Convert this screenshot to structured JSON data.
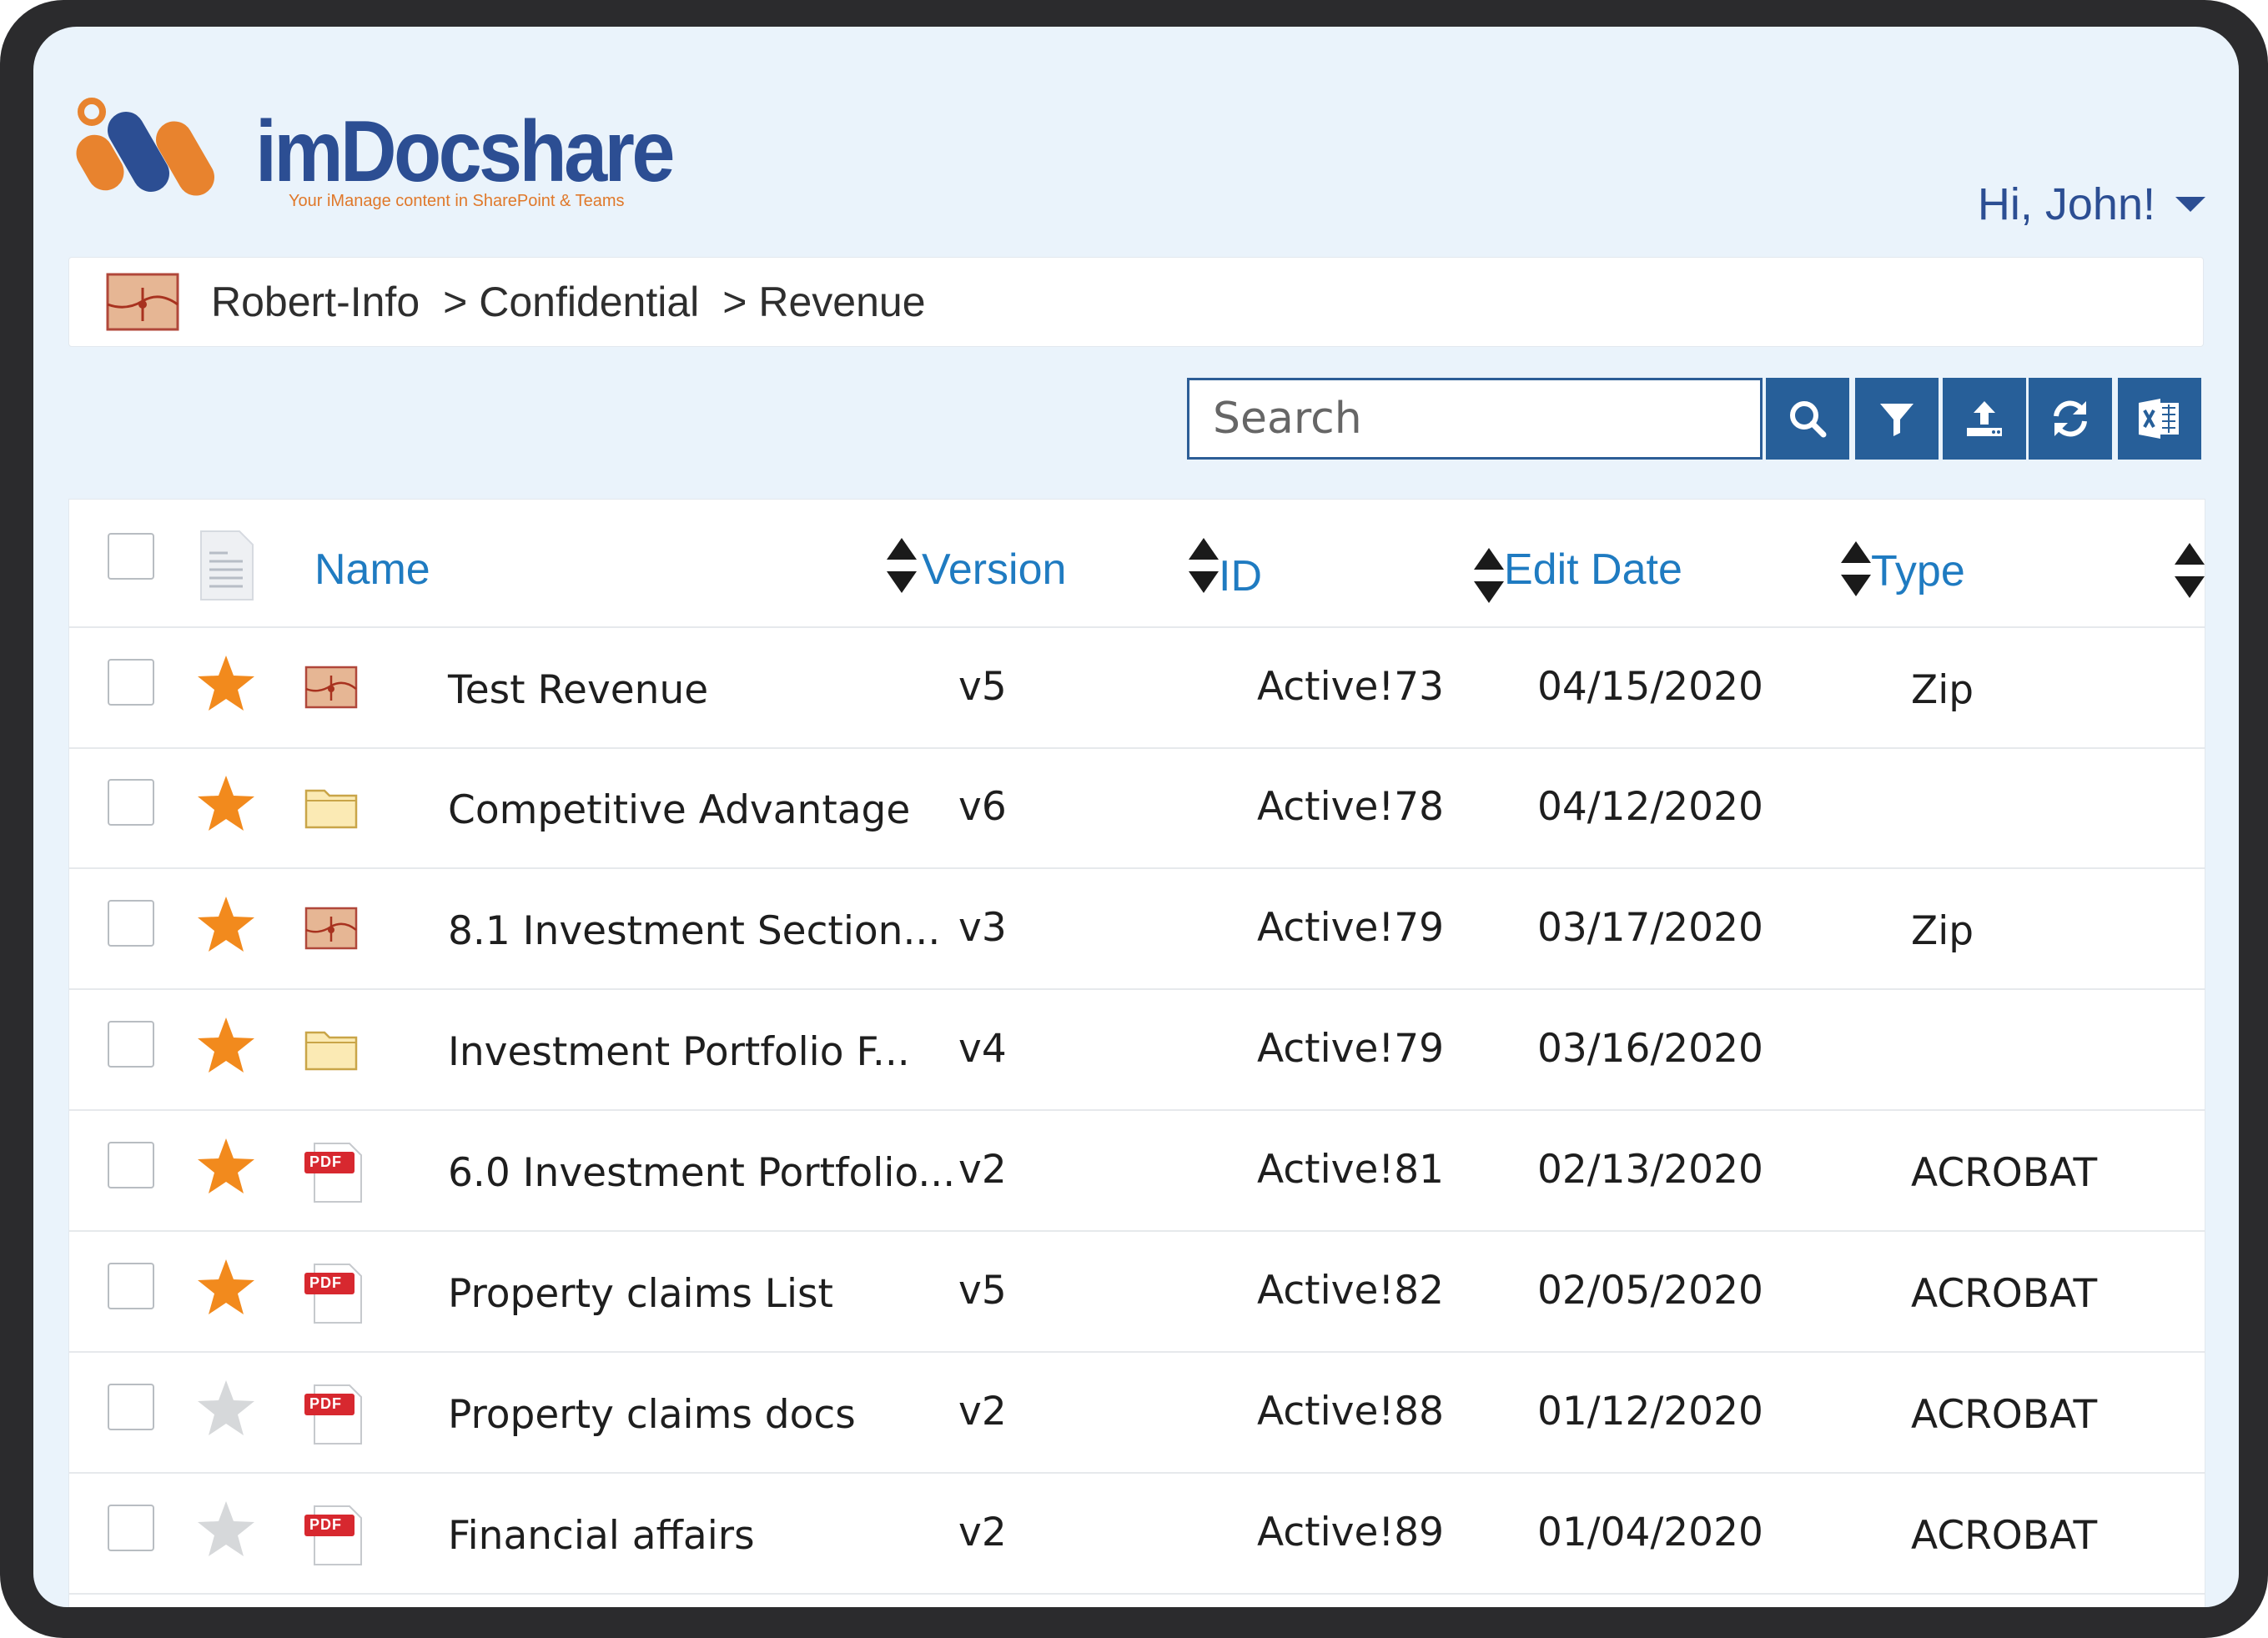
{
  "brand": {
    "name": "imDocshare",
    "tagline": "Your iManage content in SharePoint & Teams",
    "colors": {
      "orange": "#e8832e",
      "navy": "#2c4e93"
    }
  },
  "user": {
    "greeting": "Hi, John!"
  },
  "breadcrumb": {
    "items": [
      "Robert-Info",
      "> Confidential",
      "> Revenue"
    ]
  },
  "toolbar": {
    "search_placeholder": "Search",
    "buttons": [
      "search-icon",
      "filter-icon",
      "upload-icon",
      "refresh-icon",
      "excel-export-icon"
    ]
  },
  "table": {
    "columns": [
      "Name",
      "Version",
      "ID",
      "Edit Date",
      "Type"
    ],
    "rows": [
      {
        "starred": true,
        "icon": "zip-icon",
        "name": "Test Revenue",
        "version": "v5",
        "id": "Active!73",
        "date": "04/15/2020",
        "type": "Zip"
      },
      {
        "starred": true,
        "icon": "folder-icon",
        "name": "Competitive Advantage",
        "version": "v6",
        "id": "Active!78",
        "date": "04/12/2020",
        "type": ""
      },
      {
        "starred": true,
        "icon": "zip-icon",
        "name": "8.1 Investment Section...",
        "version": "v3",
        "id": "Active!79",
        "date": "03/17/2020",
        "type": "Zip"
      },
      {
        "starred": true,
        "icon": "folder-icon",
        "name": "Investment Portfolio F...",
        "version": "v4",
        "id": "Active!79",
        "date": "03/16/2020",
        "type": ""
      },
      {
        "starred": true,
        "icon": "pdf-icon",
        "name": "6.0 Investment Portfolio...",
        "version": "v2",
        "id": "Active!81",
        "date": "02/13/2020",
        "type": "ACROBAT"
      },
      {
        "starred": true,
        "icon": "pdf-icon",
        "name": "Property claims List",
        "version": "v5",
        "id": "Active!82",
        "date": "02/05/2020",
        "type": "ACROBAT"
      },
      {
        "starred": false,
        "icon": "pdf-icon",
        "name": "Property claims docs",
        "version": "v2",
        "id": "Active!88",
        "date": "01/12/2020",
        "type": "ACROBAT"
      },
      {
        "starred": false,
        "icon": "pdf-icon",
        "name": "Financial affairs",
        "version": "v2",
        "id": "Active!89",
        "date": "01/04/2020",
        "type": "ACROBAT"
      }
    ],
    "pdf_badge": "PDF",
    "colors": {
      "star_on": "#f28a1d",
      "star_off": "#d6d8da",
      "header_text": "#1f7bc1"
    }
  }
}
